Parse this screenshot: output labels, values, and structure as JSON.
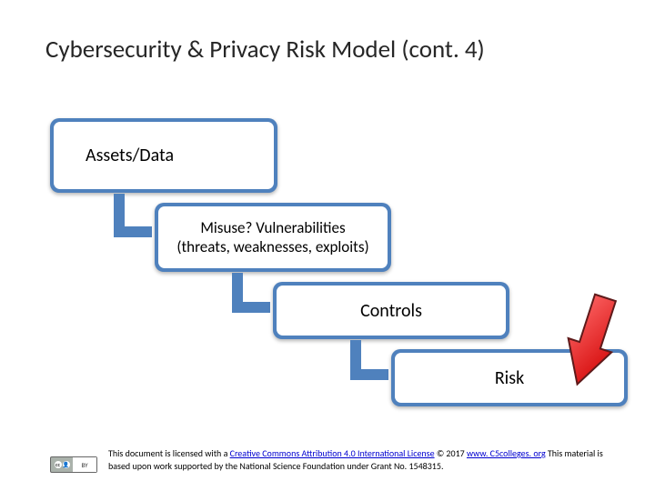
{
  "title": "Cybersecurity & Privacy Risk Model (cont. 4)",
  "boxes": {
    "b1": "Assets/Data",
    "b2_line1": "Misuse?  Vulnerabilities",
    "b2_line2": "(threats, weaknesses, exploits)",
    "b3": "Controls",
    "b4": "Risk"
  },
  "footer": {
    "prefix": "This document is licensed with a ",
    "license_link": "Creative Commons Attribution 4.0 International License",
    "mid": " © 2017 ",
    "site_link": "www. C5colleges. org",
    "suffix": " This material is based upon work supported by the National Science Foundation under Grant No. 1548315."
  },
  "cc": {
    "by": "BY",
    "cc": "cc"
  },
  "colors": {
    "box_bg": "#4f81bd",
    "arrow_fill": "#ff0000",
    "arrow_stroke": "#5e1a1a"
  }
}
